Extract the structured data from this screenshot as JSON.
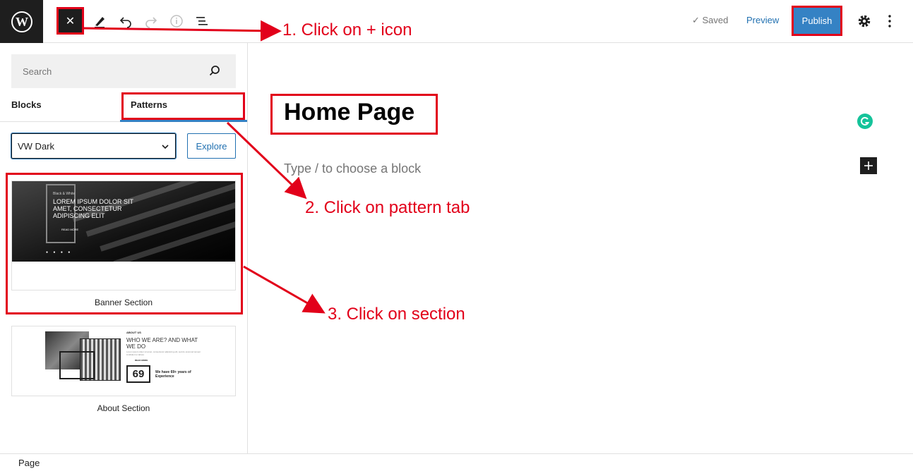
{
  "toolbar": {
    "saved_label": "Saved",
    "preview_label": "Preview",
    "publish_label": "Publish"
  },
  "sidebar": {
    "search_placeholder": "Search",
    "tabs": [
      {
        "label": "Blocks"
      },
      {
        "label": "Patterns"
      }
    ],
    "category_select": "VW Dark",
    "explore_label": "Explore",
    "patterns": [
      {
        "label": "Banner Section",
        "preview": {
          "kicker": "Black & White",
          "heading": "LOREM IPSUM DOLOR SIT AMET, CONSECTETUR ADIPISCING ELIT",
          "button": "READ MORE"
        }
      },
      {
        "label": "About Section",
        "preview": {
          "kicker": "ABOUT US",
          "heading": "WHO WE ARE? AND WHAT WE DO",
          "body": "Lorem ipsum dolor sit amet, consectetur adipiscing elit, sed do eiusmod tempor incididunt ut labore",
          "button": "READ MORE",
          "number": "69",
          "experience": "We have 69+ years of Experience"
        }
      }
    ]
  },
  "editor": {
    "page_title": "Home Page",
    "block_placeholder": "Type / to choose a block"
  },
  "statusbar": {
    "breadcrumb": "Page"
  },
  "annotations": {
    "step1": "1. Click on + icon",
    "step2": "2. Click on pattern tab",
    "step3": "3. Click on section"
  },
  "colors": {
    "annotation_red": "#e2001a",
    "accent_blue": "#3582c4",
    "link_blue": "#2271b1",
    "dark": "#1e1e1e"
  }
}
